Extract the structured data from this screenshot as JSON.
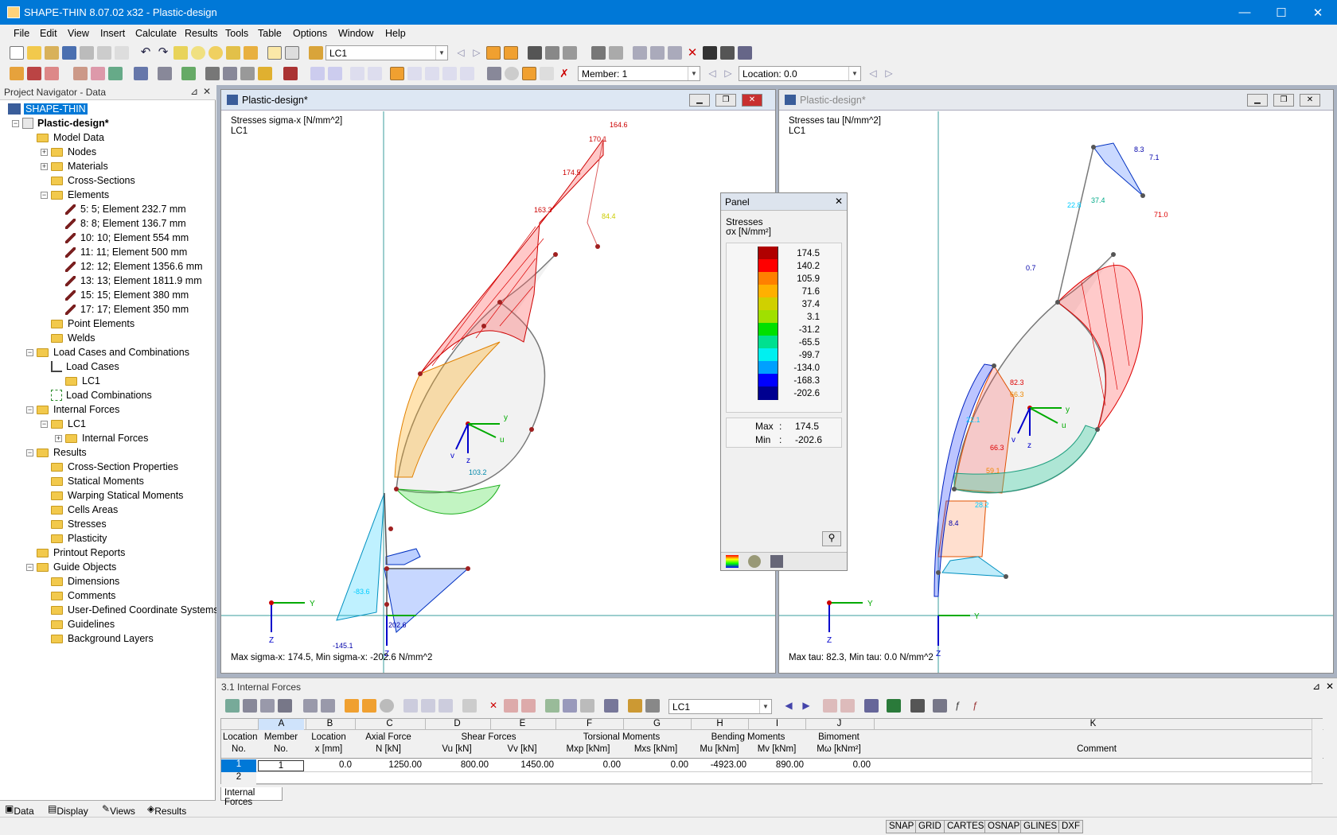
{
  "window": {
    "title": "SHAPE-THIN 8.07.02 x32 - Plastic-design",
    "minimize": "—",
    "maximize": "☐",
    "close": "✕"
  },
  "menu": [
    "File",
    "Edit",
    "View",
    "Insert",
    "Calculate",
    "Results",
    "Tools",
    "Table",
    "Options",
    "Window",
    "Help"
  ],
  "toolbar": {
    "load_case": "LC1",
    "member": "Member: 1",
    "location": "Location: 0.0"
  },
  "navigator": {
    "header": "Project Navigator - Data",
    "root": "SHAPE-THIN",
    "project": "Plastic-design*",
    "items": [
      "Model Data",
      "Nodes",
      "Materials",
      "Cross-Sections",
      "Elements",
      "5: 5; Element 232.7 mm",
      "8: 8; Element 136.7 mm",
      "10: 10; Element 554 mm",
      "11: 11; Element 500 mm",
      "12: 12; Element 1356.6 mm",
      "13: 13; Element 1811.9 mm",
      "15: 15; Element 380 mm",
      "17: 17; Element 350 mm",
      "Point Elements",
      "Welds",
      "Load Cases and Combinations",
      "Load Cases",
      "LC1",
      "Load Combinations",
      "Internal Forces",
      "LC1",
      "Internal Forces",
      "Results",
      "Cross-Section Properties",
      "Statical Moments",
      "Warping Statical Moments",
      "Cells Areas",
      "Stresses",
      "Plasticity",
      "Printout Reports",
      "Guide Objects",
      "Dimensions",
      "Comments",
      "User-Defined Coordinate Systems",
      "Guidelines",
      "Background Layers"
    ],
    "tabs": [
      "Data",
      "Display",
      "Views",
      "Results"
    ]
  },
  "view_left": {
    "title": "Plastic-design*",
    "heading": "Stresses sigma-x [N/mm^2]",
    "lc": "LC1",
    "footer": "Max sigma-x: 174.5, Min sigma-x: -202.6 N/mm^2",
    "labels": [
      "164.6",
      "170.1",
      "174.5",
      "163.3",
      "103.2",
      "-145.1",
      "202.6",
      "84.4",
      "-83.6"
    ]
  },
  "view_right": {
    "title": "Plastic-design*",
    "heading": "Stresses tau [N/mm^2]",
    "lc": "LC1",
    "footer": "Max tau: 82.3, Min tau: 0.0 N/mm^2",
    "labels": [
      "8.3",
      "7.1",
      "71.0",
      "37.4",
      "22.8",
      "0.7",
      "82.3",
      "66.3",
      "22.1",
      "66.3",
      "8.4",
      "28.2",
      "59.1"
    ]
  },
  "panel": {
    "title": "Panel",
    "subtitle": "Stresses",
    "unit": "σx [N/mm²]",
    "legend": [
      {
        "value": "174.5",
        "color": "#b00000"
      },
      {
        "value": "140.2",
        "color": "#ff0000"
      },
      {
        "value": "105.9",
        "color": "#ff8000"
      },
      {
        "value": "71.6",
        "color": "#ffb000"
      },
      {
        "value": "37.4",
        "color": "#d0d000"
      },
      {
        "value": "3.1",
        "color": "#a0e000"
      },
      {
        "value": "-31.2",
        "color": "#00e000"
      },
      {
        "value": "-65.5",
        "color": "#00e090"
      },
      {
        "value": "-99.7",
        "color": "#00f0f0"
      },
      {
        "value": "-134.0",
        "color": "#00a0ff"
      },
      {
        "value": "-168.3",
        "color": "#0000ff"
      },
      {
        "value": "-202.6",
        "color": "#000090"
      }
    ],
    "max_label": "Max",
    "max_value": "174.5",
    "min_label": "Min",
    "min_value": "-202.6"
  },
  "table": {
    "title": "3.1 Internal Forces",
    "lc": "LC1",
    "col_letters": [
      "A",
      "B",
      "C",
      "D",
      "E",
      "F",
      "G",
      "H",
      "I",
      "J",
      "K"
    ],
    "group_headers": {
      "loc": "Location",
      "locno": "No.",
      "member": "Member",
      "memberno": "No.",
      "location": "Location",
      "location_unit": "x [mm]",
      "axial": "Axial Force",
      "axial_unit": "N [kN]",
      "shear": "Shear Forces",
      "vu": "Vu [kN]",
      "vv": "Vv [kN]",
      "torsion": "Torsional Moments",
      "mxp": "Mxp [kNm]",
      "mxs": "Mxs [kNm]",
      "bending": "Bending Moments",
      "mu": "Mu [kNm]",
      "mv": "Mv [kNm]",
      "bimoment": "Bimoment",
      "mw": "Mω [kNm²]",
      "comment": "Comment"
    },
    "rows": [
      {
        "no": "1",
        "member": "1",
        "x": "0.0",
        "n": "1250.00",
        "vu": "800.00",
        "vv": "1450.00",
        "mxp": "0.00",
        "mxs": "0.00",
        "mu": "-4923.00",
        "mv": "890.00",
        "mw": "0.00"
      },
      {
        "no": "2",
        "member": "",
        "x": "",
        "n": "",
        "vu": "",
        "vv": "",
        "mxp": "",
        "mxs": "",
        "mu": "",
        "mv": "",
        "mw": ""
      }
    ],
    "tab": "Internal Forces"
  },
  "status": [
    "SNAP",
    "GRID",
    "CARTES",
    "OSNAP",
    "GLINES",
    "DXF"
  ]
}
